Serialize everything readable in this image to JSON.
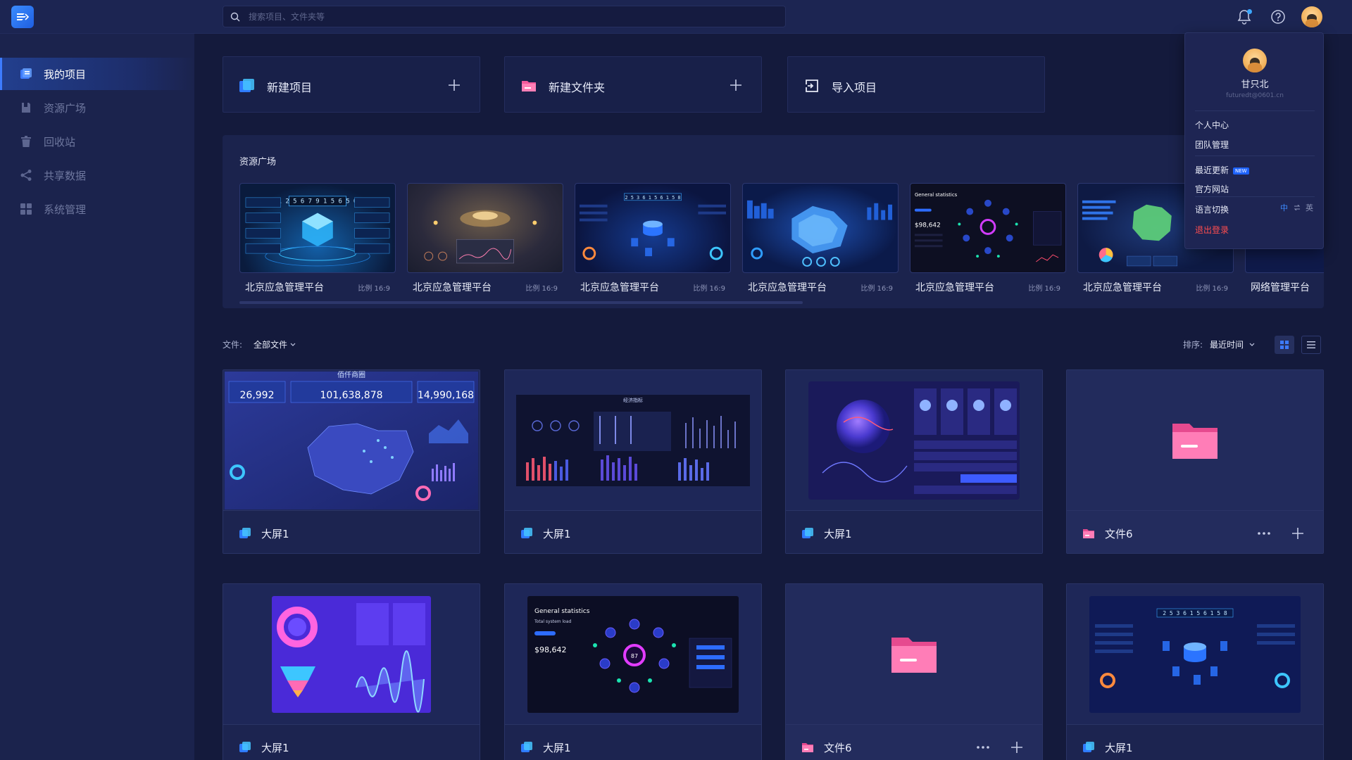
{
  "search": {
    "placeholder": "搜索项目、文件夹等"
  },
  "sidebar": {
    "items": [
      {
        "label": "我的项目",
        "icon": "project-icon",
        "active": true
      },
      {
        "label": "资源广场",
        "icon": "resource-icon"
      },
      {
        "label": "回收站",
        "icon": "trash-icon"
      },
      {
        "label": "共享数据",
        "icon": "share-icon"
      },
      {
        "label": "系统管理",
        "icon": "system-icon"
      }
    ]
  },
  "actions": {
    "new_project": "新建项目",
    "new_folder": "新建文件夹",
    "import_project": "导入项目"
  },
  "resources": {
    "title": "资源广场",
    "items": [
      {
        "name": "北京应急管理平台",
        "ratio": "比例 16:9"
      },
      {
        "name": "北京应急管理平台",
        "ratio": "比例 16:9"
      },
      {
        "name": "北京应急管理平台",
        "ratio": "比例 16:9"
      },
      {
        "name": "北京应急管理平台",
        "ratio": "比例 16:9"
      },
      {
        "name": "北京应急管理平台",
        "ratio": "比例 16:9"
      },
      {
        "name": "北京应急管理平台",
        "ratio": "比例 16:9"
      },
      {
        "name": "网络管理平台",
        "ratio": ""
      }
    ]
  },
  "filter": {
    "files_label": "文件:",
    "files_value": "全部文件",
    "sort_label": "排序:",
    "sort_value": "最近时间"
  },
  "dashboard_texts": {
    "d1_title": "佰仟商圈",
    "d1_v1": "26,992",
    "d1_v2": "101,638,878",
    "d1_v3": "14,990,168",
    "d2_title": "经济指标",
    "d7_title": "General statistics",
    "d7_sub": "Total system load",
    "d7_value": "$98,642",
    "d7_center": "87",
    "counter": "2 5 3 6 1 5 6 1 5 8",
    "r1_counter": "1 2 5 6 7 9 1 5 6 5 0",
    "r5_title": "General statistics",
    "r5_value": "$98,642"
  },
  "grid": [
    {
      "label": "大屏1",
      "type": "screen"
    },
    {
      "label": "大屏1",
      "type": "screen"
    },
    {
      "label": "大屏1",
      "type": "screen"
    },
    {
      "label": "文件6",
      "type": "folder"
    },
    {
      "label": "大屏1",
      "type": "screen"
    },
    {
      "label": "大屏1",
      "type": "screen"
    },
    {
      "label": "文件6",
      "type": "folder"
    },
    {
      "label": "大屏1",
      "type": "screen"
    }
  ],
  "user_menu": {
    "name": "甘只北",
    "email": "futuredt@0601.cn",
    "items": [
      "个人中心",
      "团队管理",
      "最近更新",
      "官方网站",
      "语言切换",
      "退出登录"
    ],
    "new_badge": "NEW",
    "lang_zh": "中",
    "lang_en": "英"
  },
  "colors": {
    "accent": "#3d7bff",
    "folder_pink": "#f25a9c",
    "logout_red": "#ff4d4f"
  }
}
